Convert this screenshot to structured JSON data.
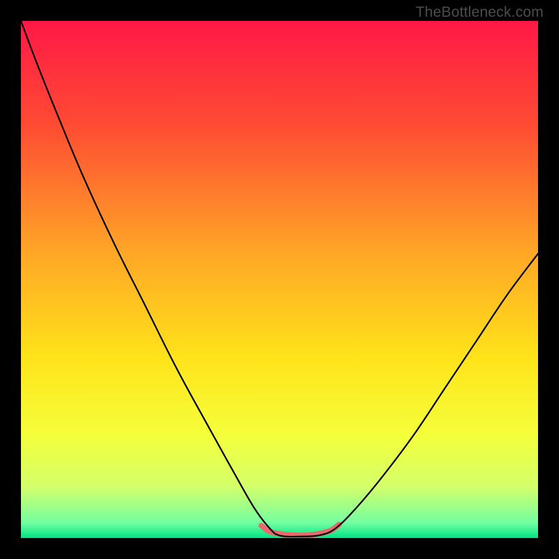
{
  "watermark": "TheBottleneck.com",
  "chart_data": {
    "type": "line",
    "title": "",
    "xlabel": "",
    "ylabel": "",
    "xlim": [
      0,
      100
    ],
    "ylim": [
      0,
      100
    ],
    "gradient_stops": [
      {
        "pct": 0,
        "color": "#ff1846"
      },
      {
        "pct": 20,
        "color": "#ff4b33"
      },
      {
        "pct": 45,
        "color": "#ffa726"
      },
      {
        "pct": 65,
        "color": "#ffe31a"
      },
      {
        "pct": 80,
        "color": "#f4ff3a"
      },
      {
        "pct": 90,
        "color": "#d4ff6a"
      },
      {
        "pct": 97,
        "color": "#74ffa0"
      },
      {
        "pct": 100,
        "color": "#00e585"
      }
    ],
    "series": [
      {
        "name": "bottleneck-curve",
        "color": "#000000",
        "width": 2.2,
        "points": [
          {
            "x": 0.0,
            "y": 100.0
          },
          {
            "x": 3.0,
            "y": 92.0
          },
          {
            "x": 7.0,
            "y": 82.0
          },
          {
            "x": 12.0,
            "y": 70.0
          },
          {
            "x": 18.0,
            "y": 57.0
          },
          {
            "x": 24.0,
            "y": 45.0
          },
          {
            "x": 30.0,
            "y": 33.0
          },
          {
            "x": 36.0,
            "y": 22.0
          },
          {
            "x": 41.0,
            "y": 13.0
          },
          {
            "x": 45.0,
            "y": 6.0
          },
          {
            "x": 48.0,
            "y": 2.0
          },
          {
            "x": 50.0,
            "y": 0.5
          },
          {
            "x": 54.0,
            "y": 0.3
          },
          {
            "x": 58.0,
            "y": 0.6
          },
          {
            "x": 61.0,
            "y": 2.0
          },
          {
            "x": 65.0,
            "y": 6.0
          },
          {
            "x": 70.0,
            "y": 12.0
          },
          {
            "x": 76.0,
            "y": 20.0
          },
          {
            "x": 82.0,
            "y": 29.0
          },
          {
            "x": 88.0,
            "y": 38.0
          },
          {
            "x": 94.0,
            "y": 47.0
          },
          {
            "x": 100.0,
            "y": 55.0
          }
        ]
      },
      {
        "name": "valley-highlight",
        "color": "#e96a6a",
        "width": 8,
        "points": [
          {
            "x": 46.5,
            "y": 2.4
          },
          {
            "x": 48.0,
            "y": 1.3
          },
          {
            "x": 50.0,
            "y": 0.8
          },
          {
            "x": 52.0,
            "y": 0.6
          },
          {
            "x": 54.0,
            "y": 0.5
          },
          {
            "x": 56.0,
            "y": 0.6
          },
          {
            "x": 58.0,
            "y": 0.9
          },
          {
            "x": 60.0,
            "y": 1.5
          },
          {
            "x": 61.5,
            "y": 2.6
          }
        ]
      }
    ]
  }
}
